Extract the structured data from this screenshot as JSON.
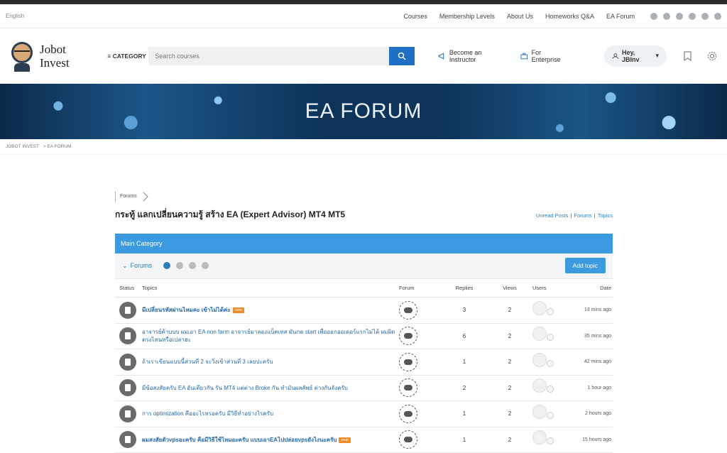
{
  "utility": {
    "language": "English",
    "nav": [
      "Courses",
      "Membership Levels",
      "About Us",
      "Homeworks Q&A",
      "EA Forum"
    ],
    "social_icons": [
      "facebook-icon",
      "twitter-icon",
      "instagram-icon",
      "skype-icon",
      "telegram-icon",
      "youtube-icon"
    ]
  },
  "header": {
    "logo_line1": "Jobot",
    "logo_line2": "Invest",
    "category_label": "≡ CATEGORY",
    "search_placeholder": "Search courses",
    "become_instructor": "Become an Instructor",
    "for_enterprise": "For Enterprise",
    "user_greeting": "Hey, JBInv"
  },
  "banner": {
    "title": "EA FORUM"
  },
  "breadcrumb": {
    "home": "JOBOT INVEST",
    "current": "> EA FORUM"
  },
  "forum": {
    "tag": "Forums",
    "title": "กระทู้ แลกเปลี่ยนความรู้ สร้าง EA (Expert Advisor) MT4 MT5",
    "links": [
      "Unread Posts",
      "Forums",
      "Topics"
    ],
    "main_category": "Main Category",
    "filter_label": "Forums",
    "add_topic": "Add topic",
    "columns": [
      "Status",
      "Topics",
      "Forum",
      "Replies",
      "Views",
      "Users",
      "Date"
    ],
    "new_label": "new",
    "rows": [
      {
        "topic": "มีเปลี่ยนรหัสผ่านไหมคะ เข้าไม่ได้ค่ะ",
        "bold": true,
        "is_new": true,
        "replies": "3",
        "views": "2",
        "date": "13 mins ago"
      },
      {
        "topic": "อาจารย์ค้าบบบ ผมเอา EA non farm อาจารย์มาลองแบ็คเทส มันกด start เพื่อออกออเดอร์แรกไม่ได้ ผมผิดตรงไหนหรือเปล่าฮะ",
        "bold": false,
        "is_new": false,
        "replies": "6",
        "views": "2",
        "date": "35 mins ago"
      },
      {
        "topic": "ถ้าเราเขียนแบบนี้ส่วนที่ 2 จะวิ่งเข้าส่วนที่ 3 เลยปะครับ",
        "bold": false,
        "is_new": false,
        "replies": "1",
        "views": "2",
        "date": "42 mins ago"
      },
      {
        "topic": "มีข้อสงสัยครับ EA อันเดียวกัน รัน MT4 แต่ต่าง Broke กัน ทำมันผลลัพธ์ ต่างกันจังครับ",
        "bold": false,
        "is_new": false,
        "replies": "2",
        "views": "2",
        "date": "1 hour ago"
      },
      {
        "topic": "การ optimization คืออะไรหรอครับ มีวิธีทำอย่างไรครับ",
        "bold": false,
        "is_new": false,
        "replies": "1",
        "views": "2",
        "date": "2 hours ago"
      },
      {
        "topic": "ผมสงสัยตัวvpsอะครับ คือมีวิธีใช้ไหมอะครับ แบบเอาEAไปปล่อยvpsยังไงนะครับ",
        "bold": true,
        "is_new": true,
        "replies": "1",
        "views": "2",
        "date": "15 hours ago"
      }
    ]
  },
  "colors": {
    "accent": "#3c9be0",
    "search_button": "#1f6fc4",
    "badge_new": "#f08a2a",
    "link": "#2569a8"
  }
}
